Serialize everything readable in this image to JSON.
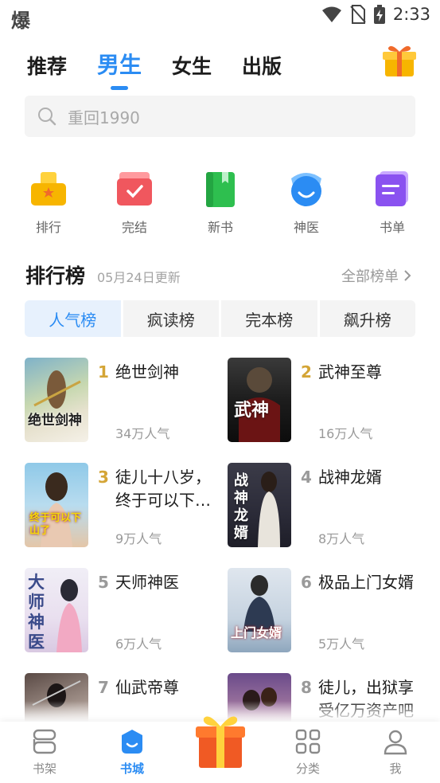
{
  "status_bar": {
    "app_glyph": "爆",
    "time": "2:33",
    "icons": [
      "wifi-icon",
      "no-sim-icon",
      "battery-charging-icon"
    ]
  },
  "top_tabs": [
    {
      "label": "推荐",
      "active": false
    },
    {
      "label": "男生",
      "active": true
    },
    {
      "label": "女生",
      "active": false
    },
    {
      "label": "出版",
      "active": false
    }
  ],
  "search": {
    "placeholder": "重回1990",
    "icon": "search-icon"
  },
  "quick_entries": [
    {
      "label": "排行",
      "icon": "ranking-icon",
      "color": "#f7b500"
    },
    {
      "label": "完结",
      "icon": "completed-icon",
      "color": "#f0575e"
    },
    {
      "label": "新书",
      "icon": "new-book-icon",
      "color": "#2ebf4f"
    },
    {
      "label": "神医",
      "icon": "doctor-icon",
      "color": "#2b8cf3"
    },
    {
      "label": "书单",
      "icon": "book-list-icon",
      "color": "#8a52f0"
    }
  ],
  "ranking": {
    "title": "排行榜",
    "updated": "05月24日更新",
    "all_label": "全部榜单",
    "tabs": [
      {
        "label": "人气榜",
        "active": true
      },
      {
        "label": "疯读榜",
        "active": false
      },
      {
        "label": "完本榜",
        "active": false
      },
      {
        "label": "飙升榜",
        "active": false
      }
    ],
    "books": [
      {
        "rank": "1",
        "title": "绝世剑神",
        "popularity": "34万人气",
        "cover_text": "绝世剑神"
      },
      {
        "rank": "2",
        "title": "武神至尊",
        "popularity": "16万人气",
        "cover_text": "武神"
      },
      {
        "rank": "3",
        "title": "徒儿十八岁，终于可以下山了",
        "popularity": "9万人气",
        "cover_text": "终于可以下山了"
      },
      {
        "rank": "4",
        "title": "战神龙婿",
        "popularity": "8万人气",
        "cover_text": "战神龙婿"
      },
      {
        "rank": "5",
        "title": "天师神医",
        "popularity": "6万人气",
        "cover_text": "大师神医"
      },
      {
        "rank": "6",
        "title": "极品上门女婿",
        "popularity": "5万人气",
        "cover_text": "上门女婿"
      },
      {
        "rank": "7",
        "title": "仙武帝尊",
        "popularity": "",
        "cover_text": ""
      },
      {
        "rank": "8",
        "title": "徒儿，出狱享受亿万资产吧",
        "popularity": "",
        "cover_text": ""
      }
    ]
  },
  "bottom_nav": [
    {
      "label": "书架",
      "icon": "bookshelf-icon",
      "active": false
    },
    {
      "label": "书城",
      "icon": "bookstore-icon",
      "active": true
    },
    {
      "label": "分类",
      "icon": "category-icon",
      "active": false
    },
    {
      "label": "我",
      "icon": "profile-icon",
      "active": false
    }
  ],
  "colors": {
    "accent": "#2b8cf3",
    "rank_gold": "#d4a536",
    "text_muted": "#999999"
  }
}
